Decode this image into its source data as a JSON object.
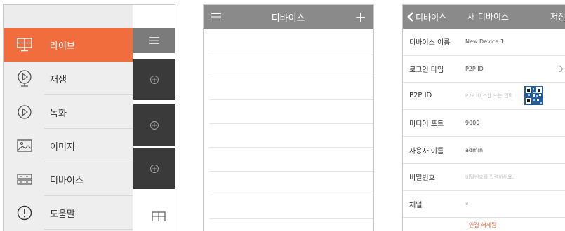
{
  "colors": {
    "accent": "#f26d3d",
    "header_gray": "#8a8a8a",
    "dark_block": "#3a3a3a"
  },
  "menu": {
    "items": [
      {
        "label": "라이브",
        "icon": "monitor-icon",
        "active": true
      },
      {
        "label": "재생",
        "icon": "play-circle-icon",
        "active": false
      },
      {
        "label": "녹화",
        "icon": "play-circle-icon",
        "active": false
      },
      {
        "label": "이미지",
        "icon": "image-icon",
        "active": false
      },
      {
        "label": "디바이스",
        "icon": "device-icon",
        "active": false
      },
      {
        "label": "도움말",
        "icon": "help-icon",
        "active": false
      }
    ]
  },
  "device_list": {
    "title": "디바이스",
    "add_symbol": "+"
  },
  "new_device": {
    "back_label": "디바이스",
    "title": "새 디바이스",
    "save_label": "저장",
    "fields": [
      {
        "label": "디바이스 이름",
        "value": "New Device 1",
        "placeholder": ""
      },
      {
        "label": "로그인 타입",
        "value": "P2P ID",
        "placeholder": ""
      },
      {
        "label": "P2P ID",
        "value": "",
        "placeholder": "P2P ID 스캔 또는 입력"
      },
      {
        "label": "미디어 포트",
        "value": "9000",
        "placeholder": ""
      },
      {
        "label": "사용자 이름",
        "value": "admin",
        "placeholder": ""
      },
      {
        "label": "비밀번호",
        "value": "",
        "placeholder": "비밀번호를 입력하세요."
      },
      {
        "label": "채널",
        "value": "",
        "placeholder": "8"
      }
    ],
    "connect_label": "연결 해제됨"
  }
}
